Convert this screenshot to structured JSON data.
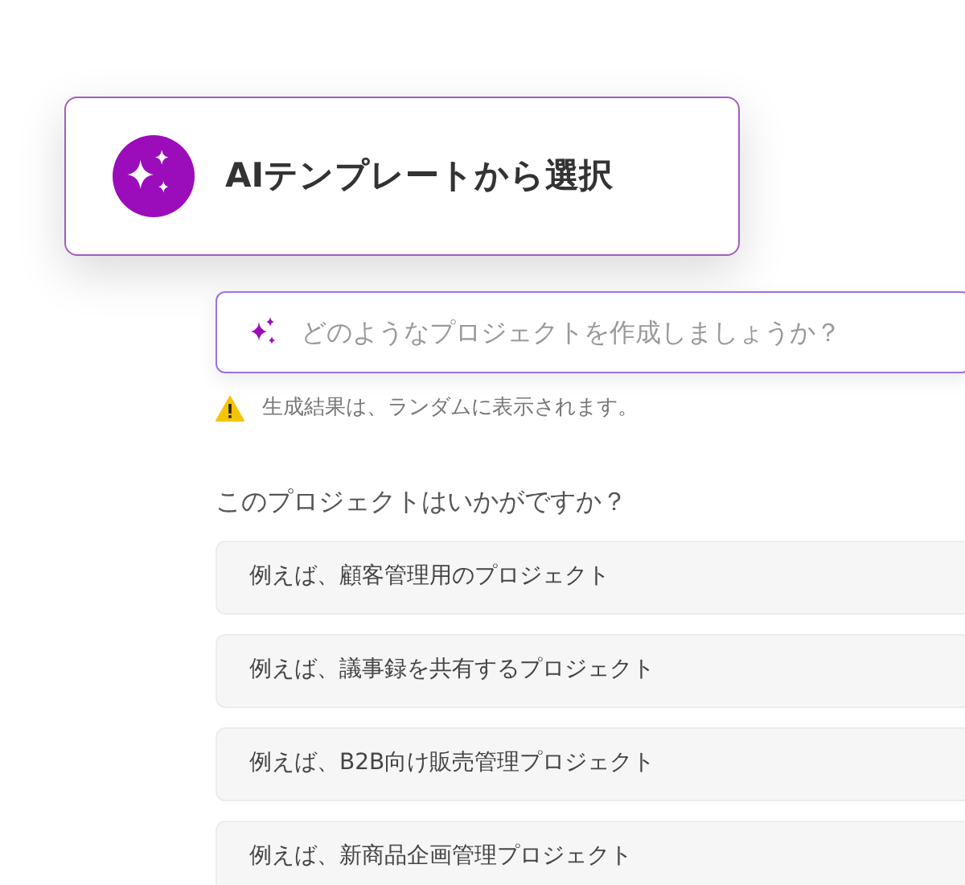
{
  "template_card": {
    "title": "AIテンプレートから選択"
  },
  "prompt_field": {
    "placeholder": "どのようなプロジェクトを作成しましょうか？"
  },
  "notice": "生成結果は、ランダムに表示されます。",
  "suggestions": {
    "heading": "このプロジェクトはいかがですか？",
    "items": [
      "例えば、顧客管理用のプロジェクト",
      "例えば、議事録を共有するプロジェクト",
      "例えば、B2B向け販売管理プロジェクト",
      "例えば、新商品企画管理プロジェクト"
    ]
  }
}
